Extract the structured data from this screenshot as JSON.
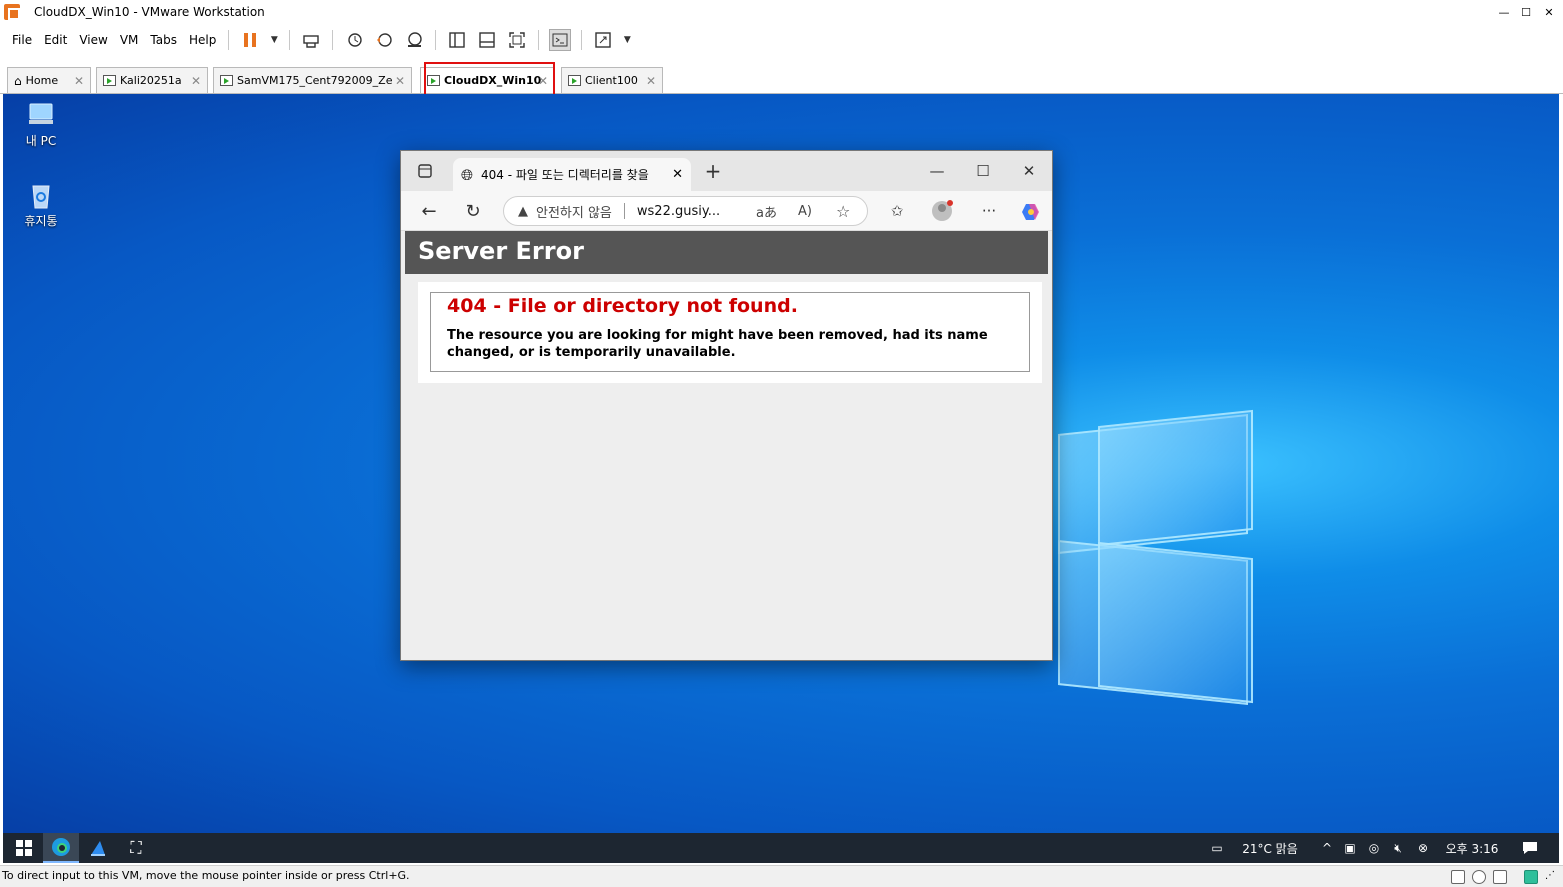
{
  "vmware": {
    "window_title": "CloudDX_Win10 - VMware Workstation",
    "menu": [
      "File",
      "Edit",
      "View",
      "VM",
      "Tabs",
      "Help"
    ],
    "tabs": [
      {
        "label": "Home"
      },
      {
        "label": "Kali20251a"
      },
      {
        "label": "SamVM175_Cent792009_Ze"
      },
      {
        "label": "CloudDX_Win10",
        "active": true
      },
      {
        "label": "Client100"
      }
    ],
    "status_text": "To direct input to this VM, move the mouse pointer inside or press Ctrl+G.",
    "accent_color": "#e8731f",
    "highlight_color": "#e01010"
  },
  "desktop": {
    "icons": [
      {
        "label": "내 PC",
        "icon": "computer-icon"
      },
      {
        "label": "휴지통",
        "icon": "recycle-bin-icon"
      }
    ]
  },
  "browser": {
    "tab_title": "404 - 파일 또는 디렉터리를 찾을",
    "security_label": "안전하지 않음",
    "url": "ws22.gusiy...",
    "read_aloud_label": "aあ",
    "text_to_speech": "A)",
    "error": {
      "header": "Server Error",
      "title": "404 - File or directory not found.",
      "message": "The resource you are looking for might have been removed, had its name changed, or is temporarily unavailable."
    }
  },
  "taskbar": {
    "weather": "21°C  맑음",
    "time": "오후 3:16"
  }
}
